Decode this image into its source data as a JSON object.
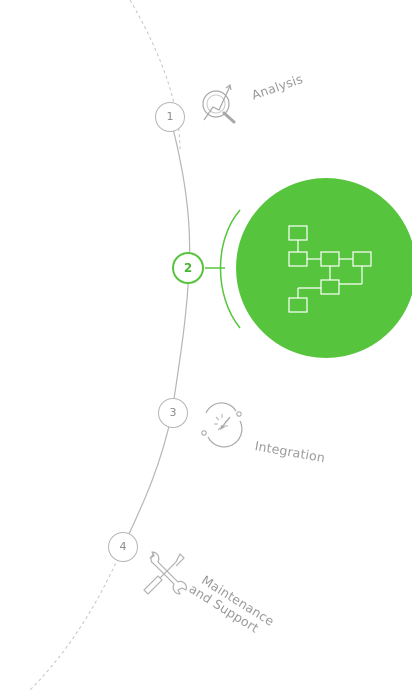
{
  "steps": [
    {
      "number": "1",
      "label": "Analysis",
      "icon": "analysis-magnifier-chart-icon",
      "active": false
    },
    {
      "number": "2",
      "label": "",
      "icon": "workflow-diagram-icon",
      "active": true
    },
    {
      "number": "3",
      "label": "Integration",
      "icon": "integration-cycle-icon",
      "active": false
    },
    {
      "number": "4",
      "label_line1": "Maintenance",
      "label_line2": "and Support",
      "icon": "wrench-screwdriver-icon",
      "active": false
    }
  ],
  "colors": {
    "accent": "#56c53d",
    "accent_dark": "#4ab532",
    "line": "#b5b5b5",
    "text": "#9a9a9a"
  }
}
